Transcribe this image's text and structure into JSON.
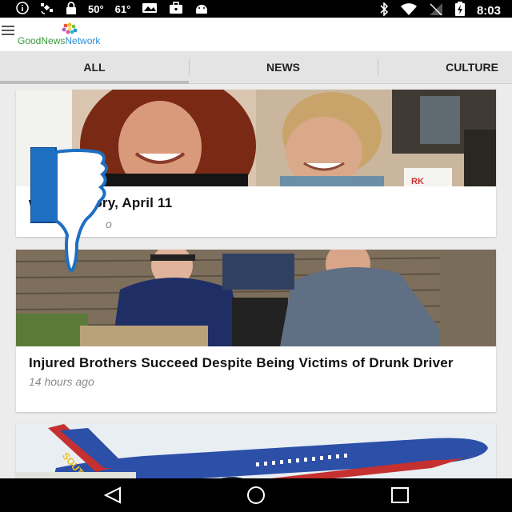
{
  "status_bar": {
    "temp1": "50°",
    "temp2": "61°",
    "time": "8:03",
    "icons": [
      "info-icon",
      "satellite-icon",
      "lock-icon",
      "photo-icon",
      "briefcase-icon",
      "android-icon",
      "bluetooth-icon",
      "wifi-icon",
      "signal-icon",
      "battery-icon"
    ]
  },
  "app": {
    "logo_part1": "GoodNews",
    "logo_part2": "Network",
    "brand_colors": {
      "green": "#3a9a3a",
      "blue": "#2a8fd6"
    }
  },
  "tabs": [
    {
      "label": "ALL",
      "selected": true
    },
    {
      "label": "NEWS",
      "selected": false
    },
    {
      "label": "CULTURE",
      "selected": false
    }
  ],
  "articles": [
    {
      "title_visible": "ws in History, April 11",
      "time_visible": "o"
    },
    {
      "title": "Injured Brothers Succeed Despite Being Victims of Drunk Driver",
      "time": "14 hours ago"
    },
    {
      "title": "",
      "time": ""
    }
  ],
  "overlay": {
    "icon": "thumbs-down-icon",
    "color": "#1e6fc2"
  },
  "navigation": [
    "back-icon",
    "home-icon",
    "recents-icon"
  ]
}
